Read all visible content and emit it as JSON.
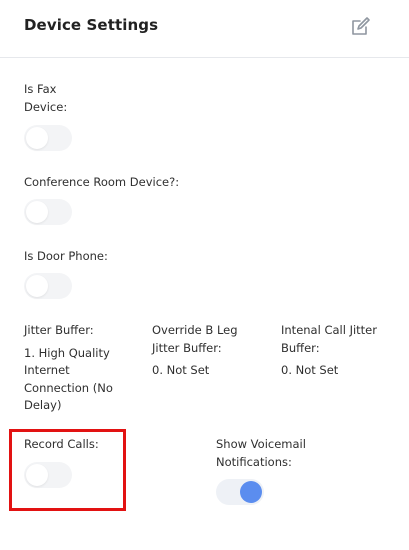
{
  "header": {
    "title": "Device Settings",
    "edit_icon": "edit-icon"
  },
  "fields": {
    "is_fax_device": {
      "label_line1": "Is Fax",
      "label_line2": "Device:",
      "value": false
    },
    "conference_room_device": {
      "label": "Conference Room Device?:",
      "value": false
    },
    "is_door_phone": {
      "label": "Is Door Phone:",
      "value": false
    },
    "jitter_buffer": {
      "label": "Jitter Buffer:",
      "value_lines": [
        "1. High Quality",
        "Internet",
        "Connection (No",
        "Delay)"
      ]
    },
    "override_b_leg_jitter_buffer": {
      "label_lines": [
        "Override B Leg",
        "Jitter Buffer:"
      ],
      "value": "0. Not Set"
    },
    "internal_call_jitter_buffer": {
      "label_lines": [
        "Intenal Call Jitter",
        "Buffer:"
      ],
      "value": "0. Not Set"
    },
    "record_calls": {
      "label": "Record Calls:",
      "value": false
    },
    "show_voicemail_notifications": {
      "label_lines": [
        "Show Voicemail",
        "Notifications:"
      ],
      "value": true
    }
  },
  "colors": {
    "toggle_on": "#5b8def",
    "toggle_off_track": "#f3f4f6",
    "highlight_border": "#e21212",
    "divider": "#e6e8ec"
  }
}
